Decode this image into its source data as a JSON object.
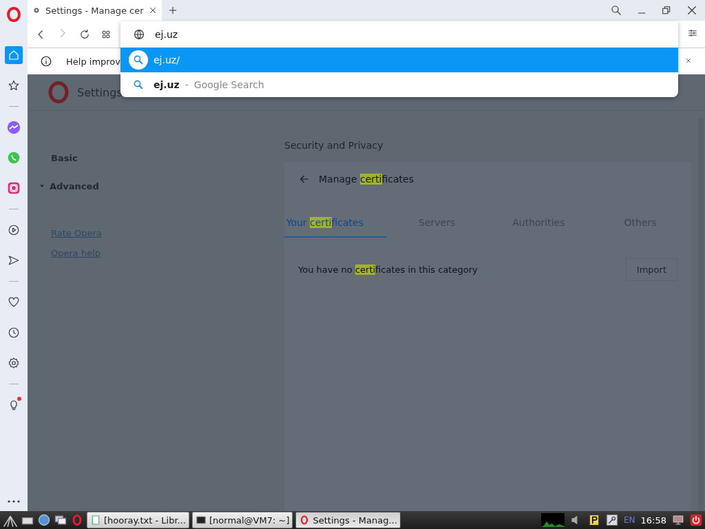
{
  "browser_sidebar": {
    "items": [
      {
        "kind": "home",
        "selected": true
      },
      {
        "kind": "bookmarks",
        "selected": false
      },
      {
        "kind": "divider"
      },
      {
        "kind": "messenger",
        "selected": false
      },
      {
        "kind": "whatsapp",
        "selected": false
      },
      {
        "kind": "instagram",
        "selected": false
      },
      {
        "kind": "divider"
      },
      {
        "kind": "player",
        "selected": false
      },
      {
        "kind": "send",
        "selected": false
      },
      {
        "kind": "divider"
      },
      {
        "kind": "heart",
        "selected": false
      },
      {
        "kind": "history",
        "selected": false
      },
      {
        "kind": "settings",
        "selected": false
      },
      {
        "kind": "divider"
      },
      {
        "kind": "tips",
        "selected": false,
        "notification": true
      }
    ]
  },
  "tabs": [
    {
      "title": "Settings - Manage cer",
      "selected": true
    }
  ],
  "address_bar": {
    "value": "ej.uz"
  },
  "suggestions": [
    {
      "kind": "url",
      "text": "ej.uz/",
      "selected": true
    },
    {
      "kind": "search",
      "text": "ej.uz",
      "separator": "-",
      "engine": "Google Search",
      "selected": false
    }
  ],
  "info_bar": {
    "text": "Help improv"
  },
  "settings": {
    "title": "Settings",
    "nav": [
      {
        "label": "Basic",
        "kind": "item"
      },
      {
        "label": "Advanced",
        "kind": "section",
        "expanded": true
      }
    ],
    "links": [
      "Rate Opera",
      "Opera help"
    ],
    "section_title": "Security and Privacy",
    "page_title": [
      {
        "text": "Manage ",
        "highlight": false
      },
      {
        "text": "certi",
        "highlight": true
      },
      {
        "text": "ficates",
        "highlight": false
      }
    ],
    "cert_tabs": [
      {
        "label": [
          {
            "text": "Your ",
            "highlight": false
          },
          {
            "text": "certi",
            "highlight": true
          },
          {
            "text": "ficates",
            "highlight": false
          }
        ],
        "selected": true
      },
      {
        "label": [
          {
            "text": "Servers",
            "highlight": false
          }
        ],
        "selected": false
      },
      {
        "label": [
          {
            "text": "Authorities",
            "highlight": false
          }
        ],
        "selected": false
      },
      {
        "label": [
          {
            "text": "Others",
            "highlight": false
          }
        ],
        "selected": false
      }
    ],
    "empty_message": [
      {
        "text": "You have no ",
        "highlight": false
      },
      {
        "text": "certi",
        "highlight": true
      },
      {
        "text": "ficates in this category",
        "highlight": false
      }
    ],
    "import_button": "Import"
  },
  "taskbar": {
    "windows": [
      {
        "title": "[hooray.txt - Libr...",
        "kind": "document",
        "selected": false
      },
      {
        "title": "[normal@VM7: ~]",
        "kind": "terminal",
        "selected": false
      },
      {
        "title": "Settings - Manag...",
        "kind": "browser",
        "selected": true
      }
    ],
    "language": "EN",
    "time": "16:58"
  }
}
